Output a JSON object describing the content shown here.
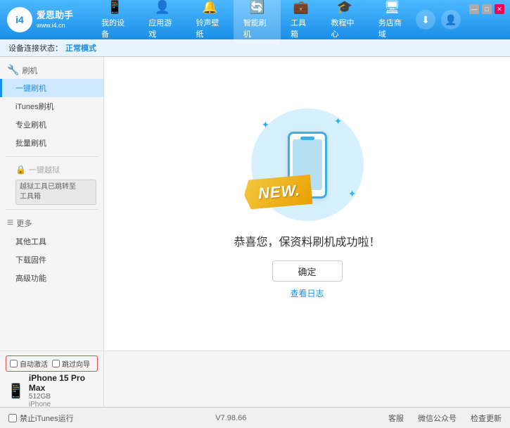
{
  "app": {
    "logo_text": "爱思助手",
    "logo_sub": "www.i4.cn",
    "logo_char": "i4"
  },
  "nav": {
    "tabs": [
      {
        "id": "my-device",
        "icon": "📱",
        "label": "我的设备"
      },
      {
        "id": "apps-games",
        "icon": "👤",
        "label": "应用游戏"
      },
      {
        "id": "ringtone",
        "icon": "🔔",
        "label": "铃声壁纸"
      },
      {
        "id": "smart-flash",
        "icon": "🔄",
        "label": "智能刷机",
        "active": true
      },
      {
        "id": "toolbox",
        "icon": "💼",
        "label": "工具箱"
      },
      {
        "id": "tutorial",
        "icon": "🎓",
        "label": "教程中心"
      },
      {
        "id": "service",
        "icon": "🖥",
        "label": "务店商域"
      }
    ]
  },
  "status_bar": {
    "label": "设备连接状态：",
    "value": "正常模式"
  },
  "sidebar": {
    "section1_icon": "🔧",
    "section1_label": "刷机",
    "items": [
      {
        "id": "one-key-flash",
        "label": "一键刷机",
        "active": true
      },
      {
        "id": "itunes-flash",
        "label": "iTunes刷机",
        "active": false
      },
      {
        "id": "pro-flash",
        "label": "专业刷机",
        "active": false
      },
      {
        "id": "batch-flash",
        "label": "批量刷机",
        "active": false
      }
    ],
    "disabled_item": {
      "label": "一键越狱",
      "note_line1": "越狱工具已跳转至",
      "note_line2": "工具箱"
    },
    "section2_icon": "≡",
    "section2_label": "更多",
    "more_items": [
      {
        "id": "other-tools",
        "label": "其他工具"
      },
      {
        "id": "download-firmware",
        "label": "下载固件"
      },
      {
        "id": "advanced",
        "label": "高级功能"
      }
    ]
  },
  "content": {
    "success_text": "恭喜您，保资料刷机成功啦！",
    "confirm_btn": "确定",
    "log_link": "查看日志",
    "new_badge": "NEW.",
    "illustration": {
      "alt": "phone with new badge"
    }
  },
  "device": {
    "checkbox1_label": "自动激活",
    "checkbox2_label": "跳过向导",
    "icon": "📱",
    "name": "iPhone 15 Pro Max",
    "storage": "512GB",
    "type": "iPhone"
  },
  "footer": {
    "itunes_label": "禁止iTunes运行",
    "version": "V7.98.66",
    "link1": "客服",
    "link2": "微信公众号",
    "link3": "检查更新"
  }
}
